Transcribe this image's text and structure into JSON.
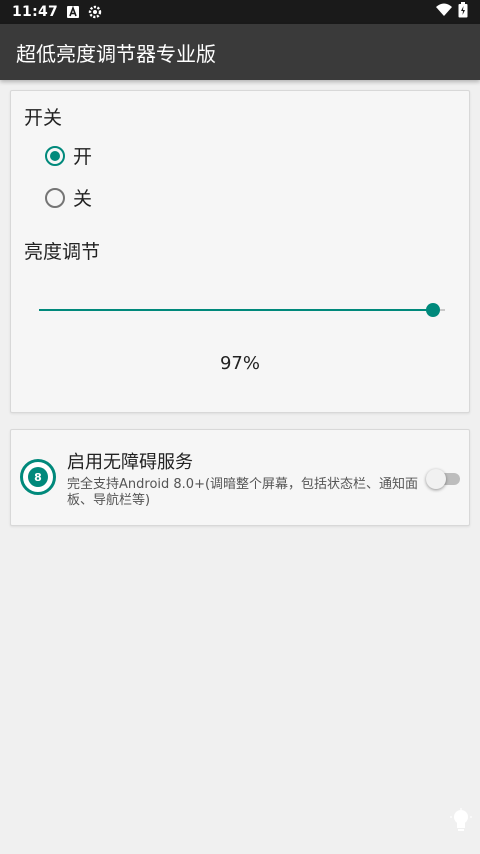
{
  "status_bar": {
    "time": "11:47",
    "left_icons": [
      "notification-a-icon",
      "settings-gear-icon"
    ],
    "right_icons": [
      "wifi-icon",
      "battery-icon"
    ]
  },
  "app_bar": {
    "title": "超低亮度调节器专业版"
  },
  "switch_section": {
    "label": "开关",
    "options": [
      {
        "label": "开",
        "selected": true
      },
      {
        "label": "关",
        "selected": false
      }
    ]
  },
  "brightness_section": {
    "label": "亮度调节",
    "value": 97,
    "value_text": "97%"
  },
  "accessibility": {
    "title": "启用无障碍服务",
    "description": "完全支持Android 8.0+(调暗整个屏幕，包括状态栏、通知面板、导航栏等)",
    "enabled": false
  },
  "colors": {
    "accent": "#00897b",
    "app_bar": "#3a3a3a",
    "status_bar": "#1a1a1a",
    "background": "#f0f0f0"
  }
}
